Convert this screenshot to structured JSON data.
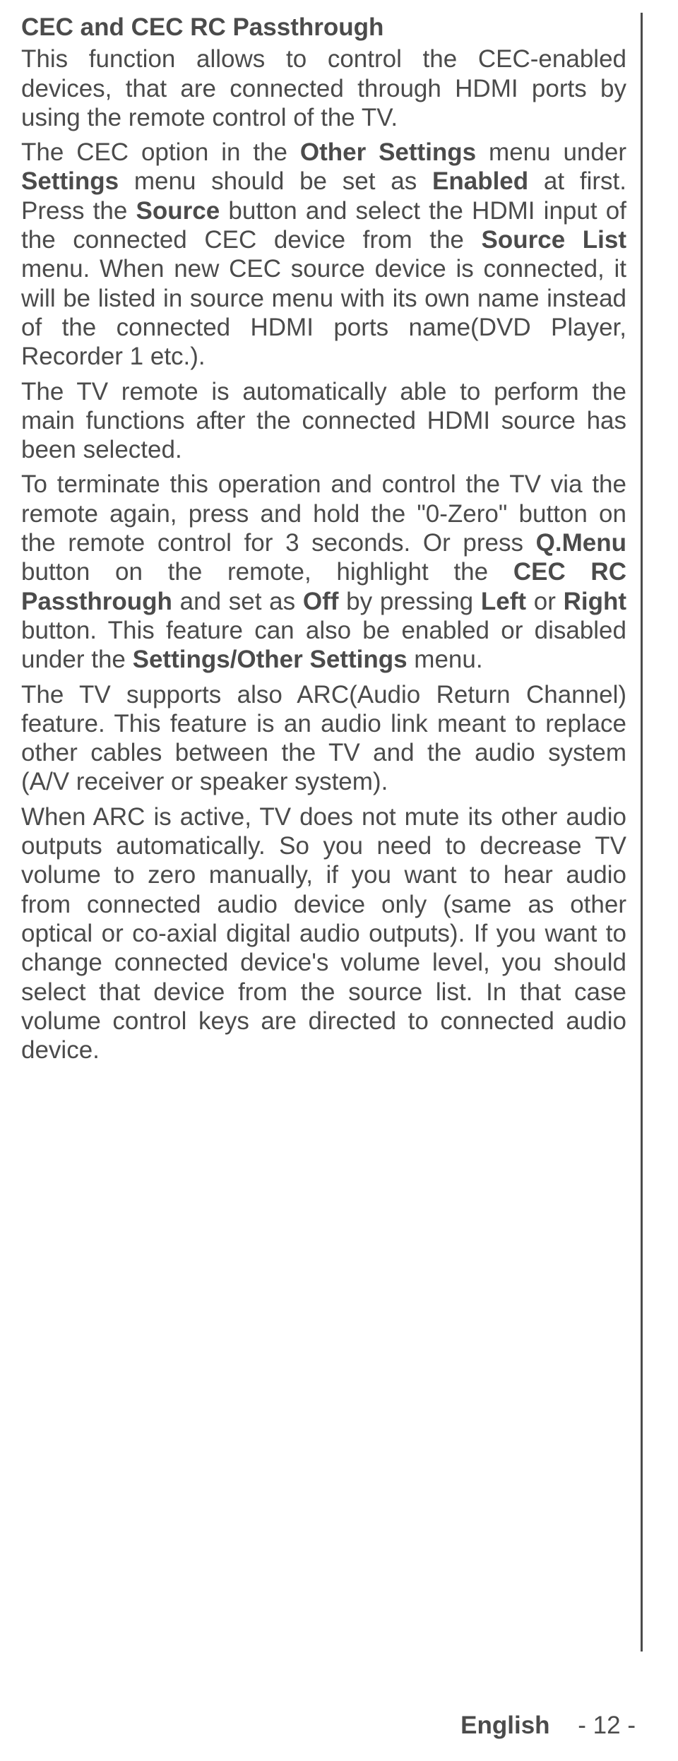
{
  "heading": "CEC and CEC RC Passthrough",
  "p1": "This function allows to control the CEC-enabled devices, that are connected through HDMI ports by using the remote control of the TV.",
  "p2_seg1": "The CEC option in the ",
  "p2_b1": "Other Settings",
  "p2_seg2": " menu under ",
  "p2_b2": "Settings",
  "p2_seg3": " menu should be set as ",
  "p2_b3": "Enabled",
  "p2_seg4": " at first. Press the ",
  "p2_b4": "Source",
  "p2_seg5": " button and select the HDMI input of the connected CEC device from the ",
  "p2_b5": "Source List",
  "p2_seg6": " menu. When new CEC source device is connected, it will be listed in source menu with its own name instead of the connected HDMI ports name(DVD Player, Recorder 1 etc.).",
  "p3": "The TV remote is automatically able to perform the main functions after the connected HDMI source has been selected.",
  "p4_seg1": "To terminate this operation and control the TV via the remote again, press and hold the \"0-Zero\" button on the remote control for 3 seconds. Or press ",
  "p4_b1": "Q.Menu",
  "p4_seg2": " button on the remote, highlight the ",
  "p4_b2": "CEC RC Passthrough",
  "p4_seg3": " and set as ",
  "p4_b3": "Off",
  "p4_seg4": " by pressing ",
  "p4_b4": "Left",
  "p4_seg5": " or ",
  "p4_b5": "Right",
  "p4_seg6": " button. This feature can also be enabled or disabled under the ",
  "p4_b6": "Settings/Other Settings",
  "p4_seg7": " menu.",
  "p5": "The TV supports also ARC(Audio Return Channel) feature. This feature is an audio link meant to replace other cables between the TV and the audio system (A/V receiver or speaker system).",
  "p6": "When ARC is active, TV does not mute its other audio outputs automatically. So you need to decrease TV volume to zero manually, if you want to hear audio from connected audio device only (same as other optical or co-axial digital audio outputs). If you want to change connected device's volume level, you should select that device from the source list. In that case volume control keys are directed to connected audio device.",
  "footer_lang": "English",
  "footer_page": "- 12 -"
}
